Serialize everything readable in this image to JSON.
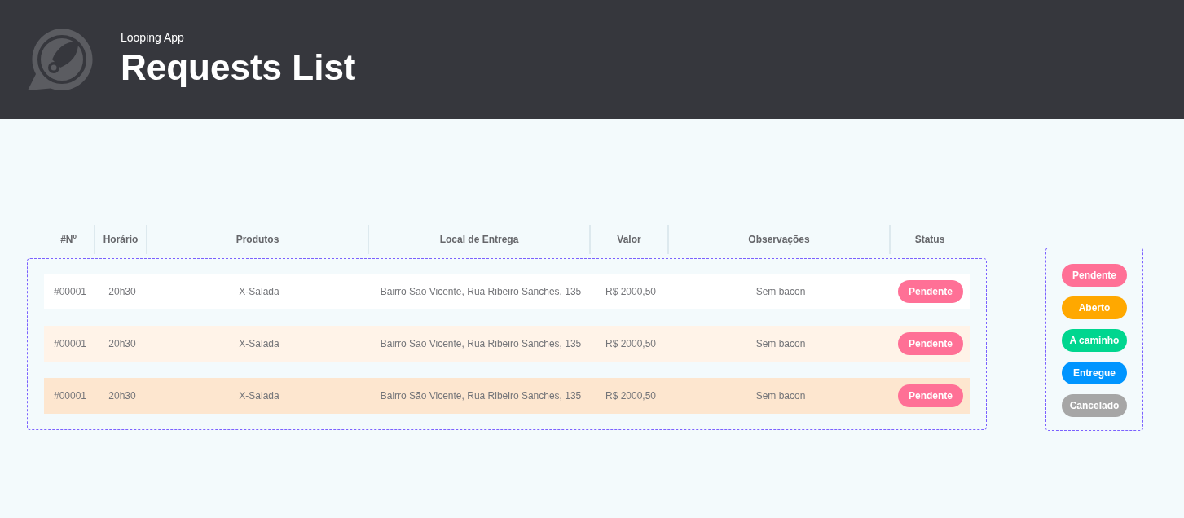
{
  "header": {
    "app_name": "Looping App",
    "title": "Requests List"
  },
  "table": {
    "columns": [
      "#Nº",
      "Horário",
      "Produtos",
      "Local de Entrega",
      "Valor",
      "Observações",
      "Status"
    ],
    "rows": [
      {
        "color": "#ffffff",
        "cells": [
          "#00001",
          "20h30",
          "X-Salada",
          "Bairro São Vicente, Rua Ribeiro Sanches, 135",
          "R$ 2000,50",
          "Sem bacon"
        ],
        "status": {
          "label": "Pendente",
          "color": "#ff7096"
        }
      },
      {
        "color": "#fff3e8",
        "cells": [
          "#00001",
          "20h30",
          "X-Salada",
          "Bairro São Vicente, Rua Ribeiro Sanches, 135",
          "R$ 2000,50",
          "Sem bacon"
        ],
        "status": {
          "label": "Pendente",
          "color": "#ff7096"
        }
      },
      {
        "color": "#fde6cf",
        "cells": [
          "#00001",
          "20h30",
          "X-Salada",
          "Bairro São Vicente, Rua Ribeiro Sanches, 135",
          "R$ 2000,50",
          "Sem bacon"
        ],
        "status": {
          "label": "Pendente",
          "color": "#ff7096"
        }
      }
    ]
  },
  "legend": [
    {
      "label": "Pendente",
      "color": "#ff7096"
    },
    {
      "label": "Aberto",
      "color": "#ffa800"
    },
    {
      "label": "A caminho",
      "color": "#00d68f"
    },
    {
      "label": "Entregue",
      "color": "#0095ff"
    },
    {
      "label": "Cancelado",
      "color": "#a6a6a6"
    }
  ]
}
